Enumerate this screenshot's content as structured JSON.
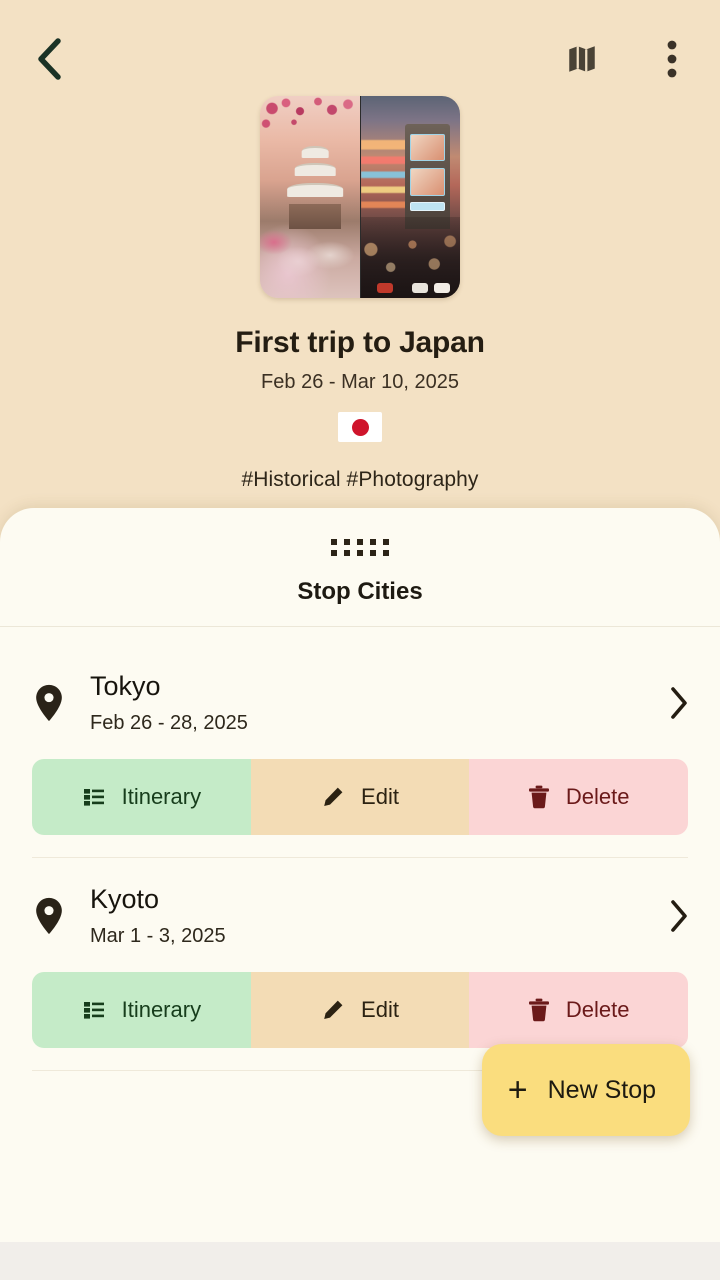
{
  "appbar": {
    "back_icon": "chevron-left-icon",
    "map_icon": "map-icon",
    "more_icon": "more-vertical-icon"
  },
  "hero": {
    "cover_alt": "japan-castle-and-tokyo-crossing",
    "title": "First trip to Japan",
    "dates": "Feb 26 - Mar 10, 2025",
    "flag": "japan-flag",
    "tags": "#Historical #Photography"
  },
  "sheet": {
    "grabber": "drag-handle",
    "title": "Stop Cities",
    "stops": [
      {
        "name": "Tokyo",
        "dates": "Feb 26 - 28, 2025",
        "pin_icon": "map-pin-icon",
        "chevron_icon": "chevron-right-icon",
        "actions": [
          {
            "label": "Itinerary",
            "icon": "list-icon"
          },
          {
            "label": "Edit",
            "icon": "pencil-icon"
          },
          {
            "label": "Delete",
            "icon": "trash-icon"
          }
        ]
      },
      {
        "name": "Kyoto",
        "dates": "Mar 1 - 3, 2025",
        "pin_icon": "map-pin-icon",
        "chevron_icon": "chevron-right-icon",
        "actions": [
          {
            "label": "Itinerary",
            "icon": "list-icon"
          },
          {
            "label": "Edit",
            "icon": "pencil-icon"
          },
          {
            "label": "Delete",
            "icon": "trash-icon"
          }
        ]
      }
    ]
  },
  "fab": {
    "plus": "+",
    "label": "New Stop"
  },
  "colors": {
    "page_background": "#f3e1c4",
    "sheet_background": "#fdfbf2",
    "itinerary_button": "#c5ebc8",
    "edit_button": "#f3dcb5",
    "delete_button": "#fbd5d5",
    "delete_text": "#6b1a1a",
    "fab_background": "#fadd7e",
    "flag_circle": "#cf142b",
    "text_primary": "#1e1a12"
  }
}
